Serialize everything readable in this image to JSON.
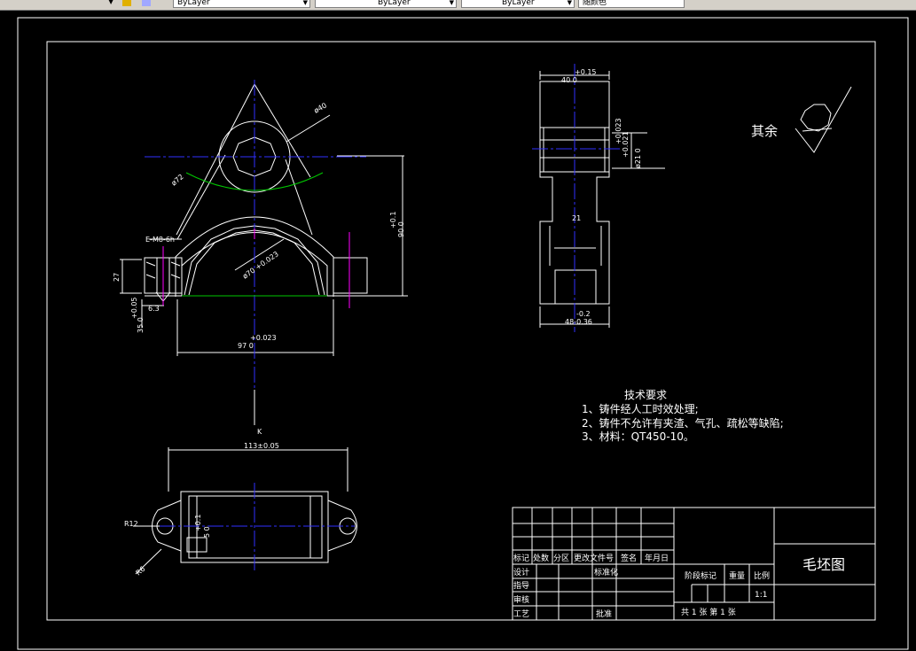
{
  "toolbar": {
    "layer1": "ByLayer",
    "layer2": "ByLayer",
    "layer3": "ByLayer",
    "color": "随颜色"
  },
  "colors": {
    "line": "#ffffff",
    "center": "#3030ff",
    "green": "#00c800",
    "magenta": "#ff00ff"
  },
  "front_view": {
    "dia_label": "ø40",
    "r_label": "ø72",
    "thread_label": "E-M8-6h",
    "height_tol": "+0.1",
    "height_val": "90 0",
    "inner_dia": "ø70 +0.023",
    "inner_dia_low": "0",
    "depth_label": "27",
    "small_dim": "6.3",
    "tol_small": "+0.05",
    "dim_35": "35 0",
    "width_tol": "+0.023",
    "width_val": "97 0",
    "k_label": "K"
  },
  "side_view": {
    "top_tol": "+0.15",
    "top_val": "40 0",
    "dim_21": "21",
    "tol_a": "+0.023",
    "tol_b": "+0.021",
    "tol_c": "ø21 0",
    "bottom_tol": "-0.2",
    "bottom_val": "48-0.36"
  },
  "bottom_view": {
    "length_label": "113±0.05",
    "r12": "R12",
    "r6": "R6",
    "tol": "+0.1",
    "tol_val": "5 0"
  },
  "roughness": {
    "label": "其余"
  },
  "tech": {
    "title": "技术要求",
    "line1": "1、铸件经人工时效处理;",
    "line2": "2、铸件不允许有夹渣、气孔、疏松等缺陷;",
    "line3": "3、材料：QT450-10。"
  },
  "title_block": {
    "name": "毛坯图",
    "h_mark": "标记",
    "h_count": "处数",
    "h_zone": "分区",
    "h_doc": "更改文件号",
    "h_sign": "签名",
    "h_date": "年月日",
    "r_design": "设计",
    "r_std": "标准化",
    "r_guide": "指导",
    "r_check": "审核",
    "r_craft": "工艺",
    "r_approve": "批准",
    "stage": "阶段标记",
    "weight": "重量",
    "scale": "比例",
    "scale_val": "1:1",
    "sheets": "共 1 张  第 1 张"
  }
}
